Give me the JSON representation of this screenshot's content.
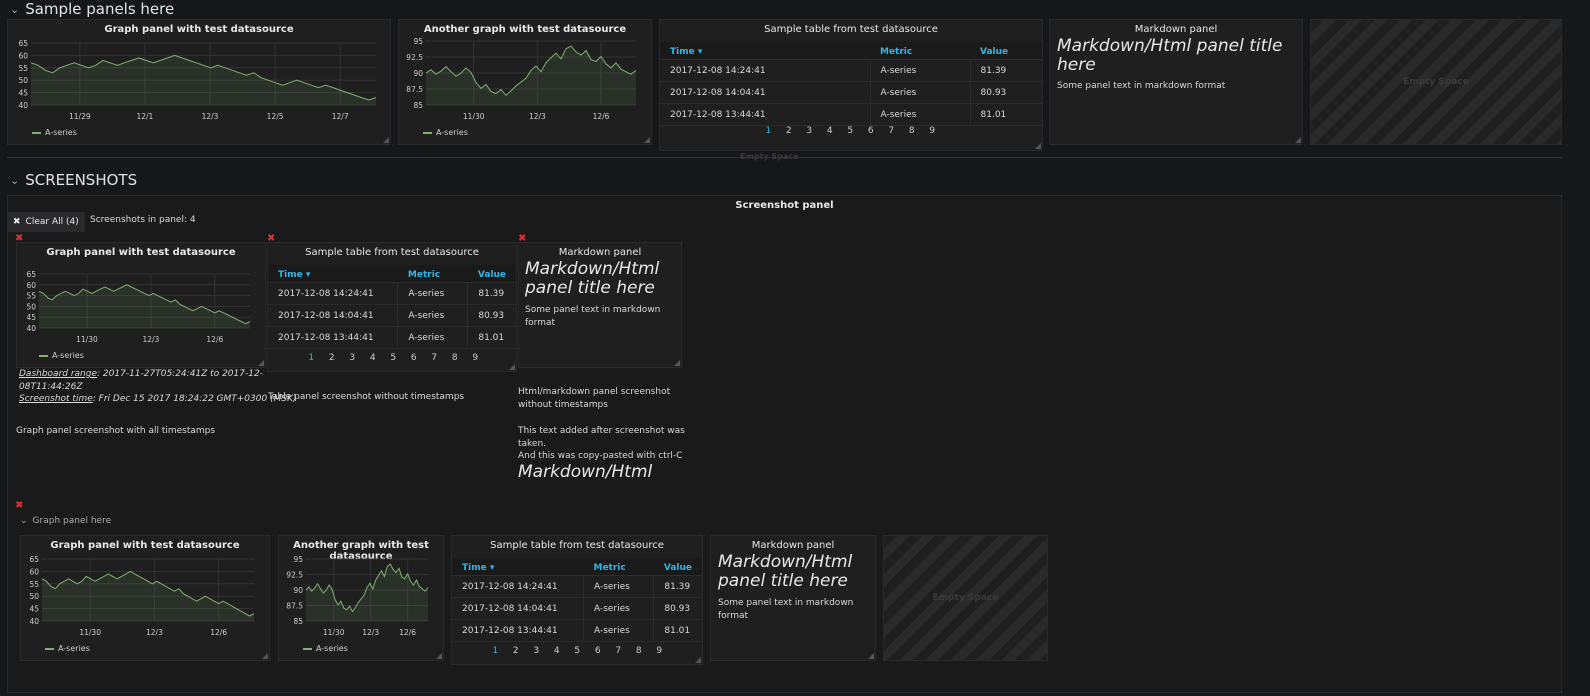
{
  "rows": {
    "sample": "Sample panels here",
    "screenshots": "SCREENSHOTS",
    "graph_row": "Graph panel here"
  },
  "panels": {
    "graph1_title": "Graph panel with test datasource",
    "graph2_title": "Another graph with test datasource",
    "table_title": "Sample table from test datasource",
    "markdown_title": "Markdown panel",
    "empty_space": "Empty Space",
    "screenshot_panel_title": "Screenshot panel"
  },
  "legend": "A-series",
  "table": {
    "headers": [
      "Time ▾",
      "Metric",
      "Value"
    ],
    "rows": [
      [
        "2017-12-08 14:24:41",
        "A-series",
        "81.39"
      ],
      [
        "2017-12-08 14:04:41",
        "A-series",
        "80.93"
      ],
      [
        "2017-12-08 13:44:41",
        "A-series",
        "81.01"
      ]
    ],
    "pages": [
      "1",
      "2",
      "3",
      "4",
      "5",
      "6",
      "7",
      "8",
      "9"
    ]
  },
  "markdown": {
    "heading": "Markdown/Html panel title here",
    "text": "Some panel text in markdown format"
  },
  "screenshots": {
    "clear_all": "Clear All (4)",
    "count_text": "Screenshots in panel: 4",
    "dashboard_range_label": "Dashboard range",
    "dashboard_range_value": ": 2017-11-27T05:24:41Z to 2017-12-08T11:44:26Z",
    "screenshot_time_label": "Screenshot time",
    "screenshot_time_value": ": Fri Dec 15 2017 18:24:22 GMT+0300 (MSK)",
    "graph_caption": "Graph panel screenshot with all timestamps",
    "table_caption": "Table panel screenshot without timestamps",
    "html_caption_1": "Html/markdown panel screenshot without timestamps",
    "html_caption_2": "This text added after screenshot was taken.",
    "html_caption_3": "And this was copy-pasted with ctrl-C",
    "html_caption_4": "Markdown/Html"
  },
  "colors": {
    "background": "#161719",
    "panel": "#1f1f20",
    "series": "#7eb26d",
    "link": "#33b5e5",
    "remove": "#e02f2f"
  },
  "chart_data": [
    {
      "id": "graph1",
      "type": "area",
      "title": "Graph panel with test datasource",
      "x_ticks": [
        "11/29",
        "12/1",
        "12/3",
        "12/5",
        "12/7"
      ],
      "y_ticks": [
        40,
        45,
        50,
        55,
        60,
        65
      ],
      "ylim": [
        40,
        65
      ],
      "series": [
        {
          "name": "A-series",
          "values": [
            57,
            56,
            54,
            53,
            55,
            56,
            57,
            56,
            55,
            56,
            58,
            57,
            56,
            57,
            58,
            59,
            58,
            57,
            58,
            59,
            60,
            59,
            58,
            57,
            56,
            55,
            56,
            55,
            54,
            53,
            52,
            53,
            51,
            50,
            49,
            48,
            49,
            50,
            49,
            48,
            47,
            48,
            47,
            46,
            45,
            44,
            43,
            42,
            43
          ]
        }
      ],
      "legend": "A-series",
      "grid": true
    },
    {
      "id": "graph2",
      "type": "area",
      "title": "Another graph with test datasource",
      "x_ticks": [
        "11/30",
        "12/3",
        "12/6"
      ],
      "y_ticks": [
        85.0,
        87.5,
        90.0,
        92.5,
        95.0
      ],
      "ylim": [
        85,
        95
      ],
      "series": [
        {
          "name": "A-series",
          "values": [
            90,
            90.5,
            89.8,
            90.3,
            91,
            90.2,
            89.5,
            90,
            90.8,
            90.1,
            88.5,
            87.6,
            88.2,
            87.1,
            86.8,
            87.4,
            86.5,
            87.2,
            88,
            88.6,
            89.2,
            90.4,
            91.1,
            90.2,
            91.6,
            92.4,
            93.1,
            92.2,
            93.8,
            94.2,
            93.3,
            92.8,
            93.5,
            92.1,
            91.8,
            92.6,
            91.4,
            90.8,
            91.6,
            90.6,
            90.2,
            89.8,
            90.4
          ]
        }
      ],
      "legend": "A-series",
      "grid": true
    }
  ]
}
